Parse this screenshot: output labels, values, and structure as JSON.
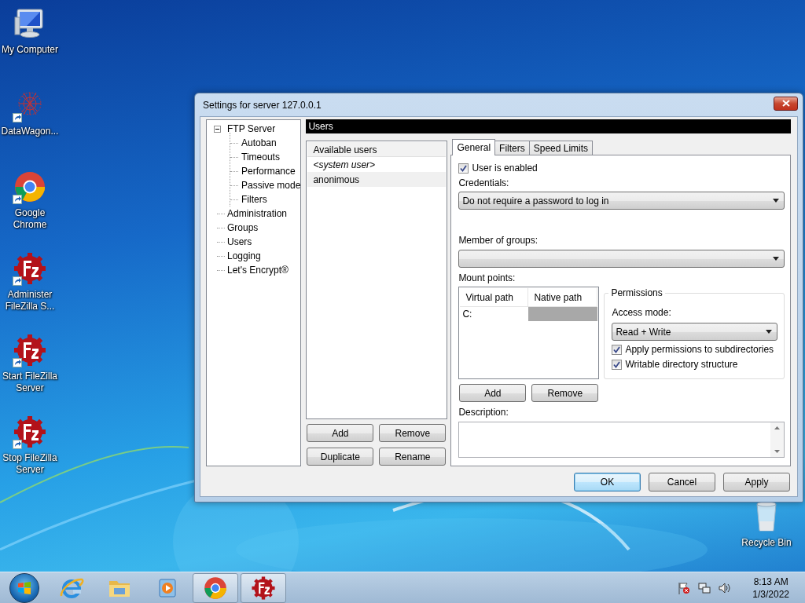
{
  "desktop_icons": [
    {
      "label": "My Computer",
      "kind": "computer",
      "shortcut": false
    },
    {
      "label": "DataWagon...",
      "kind": "network",
      "shortcut": true
    },
    {
      "label": "Google Chrome",
      "kind": "chrome",
      "shortcut": true
    },
    {
      "label": "Administer FileZilla S...",
      "kind": "filezilla",
      "shortcut": true
    },
    {
      "label": "Start FileZilla Server",
      "kind": "filezilla",
      "shortcut": true
    },
    {
      "label": "Stop FileZilla Server",
      "kind": "filezilla",
      "shortcut": true
    }
  ],
  "recycle_bin": {
    "label": "Recycle Bin"
  },
  "window": {
    "title": "Settings for server 127.0.0.1"
  },
  "tree": [
    {
      "label": "FTP Server",
      "expanded": true,
      "children": [
        {
          "label": "Autoban"
        },
        {
          "label": "Timeouts"
        },
        {
          "label": "Performance"
        },
        {
          "label": "Passive mode"
        },
        {
          "label": "Filters"
        }
      ]
    },
    {
      "label": "Administration"
    },
    {
      "label": "Groups"
    },
    {
      "label": "Users"
    },
    {
      "label": "Logging"
    },
    {
      "label": "Let's Encrypt®"
    }
  ],
  "section_title": "Users",
  "users": {
    "header": "Available users",
    "items": [
      {
        "label": "<system user>",
        "kind": "system",
        "selected": false
      },
      {
        "label": "anonimous",
        "kind": "user",
        "selected": true
      }
    ],
    "buttons": [
      "Add",
      "Remove",
      "Duplicate",
      "Rename"
    ]
  },
  "tabs": [
    {
      "label": "General",
      "selected": true
    },
    {
      "label": "Filters",
      "selected": false
    },
    {
      "label": "Speed Limits",
      "selected": false
    }
  ],
  "general": {
    "enabled": {
      "label": "User is enabled",
      "checked": true
    },
    "credentials_label": "Credentials:",
    "credentials": "Do not require a password to log in",
    "groups_label": "Member of groups:",
    "mount_label": "Mount points:",
    "mount_columns": [
      "Virtual path",
      "Native path"
    ],
    "mount_rows": [
      {
        "virtual_path": "C:",
        "selected": true
      }
    ],
    "mount_buttons": [
      "Add",
      "Remove"
    ],
    "permissions": {
      "title": "Permissions",
      "access_label": "Access mode:",
      "access_mode": "Read + Write",
      "options": [
        {
          "label": "Apply permissions to subdirectories",
          "checked": true
        },
        {
          "label": "Writable directory structure",
          "checked": true
        }
      ]
    },
    "description_label": "Description:"
  },
  "dialog_buttons": [
    {
      "label": "OK",
      "default": true
    },
    {
      "label": "Cancel",
      "default": false
    },
    {
      "label": "Apply",
      "default": false
    }
  ],
  "taskbar": {
    "apps": [
      {
        "kind": "ie",
        "active": false
      },
      {
        "kind": "explorer",
        "active": false
      },
      {
        "kind": "media",
        "active": false
      },
      {
        "kind": "chrome",
        "active": true
      },
      {
        "kind": "filezilla",
        "active": true
      }
    ],
    "tray": {
      "time": "8:13 AM",
      "date": "1/3/2022"
    }
  }
}
